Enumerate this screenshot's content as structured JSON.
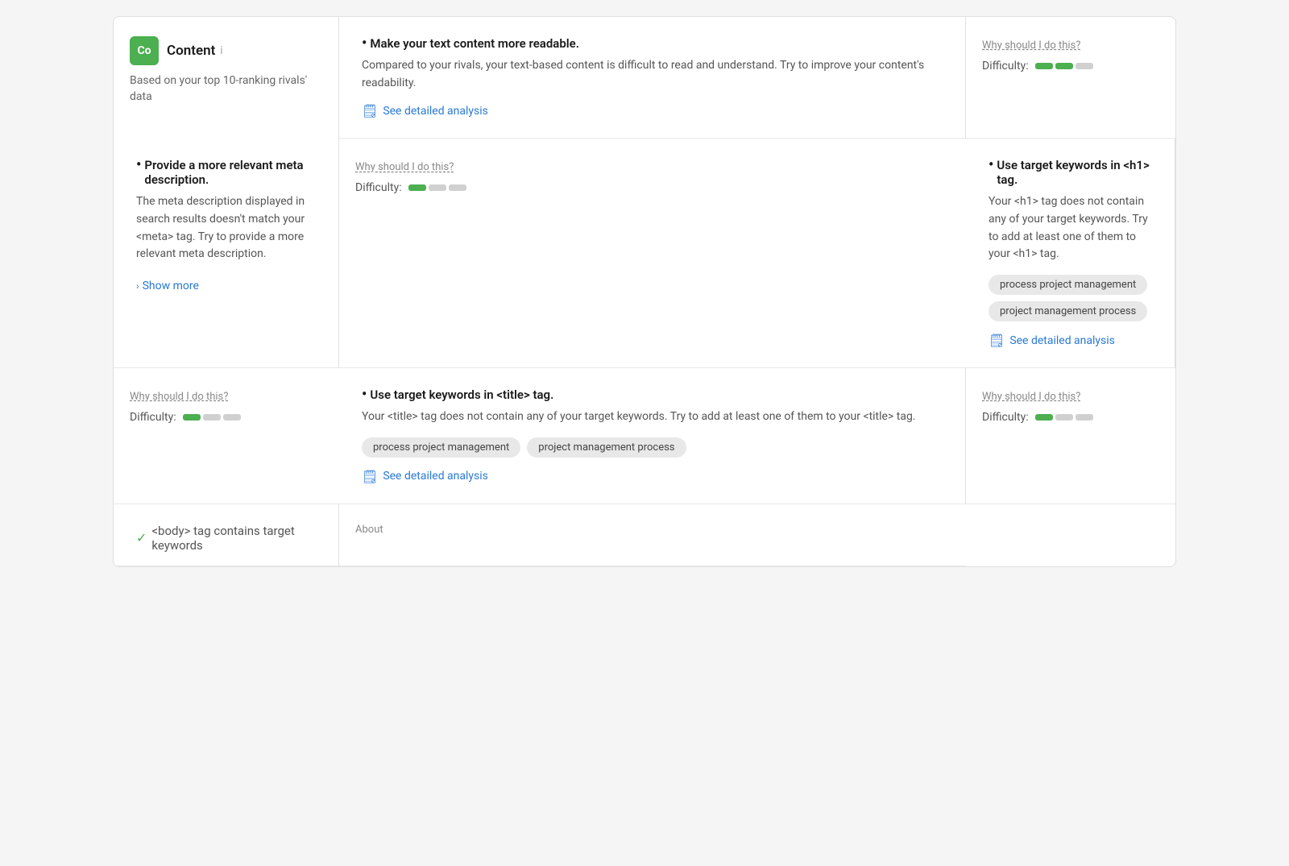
{
  "sidebar": {
    "logo_text": "Co",
    "logo_bg": "#4CAF50",
    "title": "Content",
    "subtitle": "Based on your top 10-ranking rivals' data"
  },
  "rows": [
    {
      "id": "readability",
      "title": "Make your text content more readable.",
      "description": "Compared to your rivals, your text-based content is difficult to read and understand. Try to improve your content's readability.",
      "action_type": "detail_link",
      "action_label": "See detailed analysis",
      "difficulty_bars": [
        2,
        3
      ],
      "why_label": "Why should I do this?"
    },
    {
      "id": "meta-description",
      "title": "Provide a more relevant meta description.",
      "description": "The meta description displayed in search results doesn't match your <meta> tag. Try to provide a more relevant meta description.",
      "action_type": "show_more",
      "action_label": "Show more",
      "difficulty_bars": [
        1,
        3
      ],
      "why_label": "Why should I do this?"
    },
    {
      "id": "h1-keywords",
      "title": "Use target keywords in <h1> tag.",
      "description": "Your <h1> tag does not contain any of your target keywords. Try to add at least one of them to your <h1> tag.",
      "tags": [
        "process project management",
        "project management process"
      ],
      "action_type": "detail_link",
      "action_label": "See detailed analysis",
      "difficulty_bars": [
        1,
        3
      ],
      "why_label": "Why should I do this?"
    },
    {
      "id": "title-keywords",
      "title": "Use target keywords in <title> tag.",
      "description": "Your <title> tag does not contain any of your target keywords. Try to add at least one of them to your <title> tag.",
      "tags": [
        "process project management",
        "project management process"
      ],
      "action_type": "detail_link",
      "action_label": "See detailed analysis",
      "difficulty_bars": [
        1,
        3
      ],
      "why_label": "Why should I do this?"
    }
  ],
  "partial_row": {
    "title": "<body> tag contains target keywords",
    "aside_label": "About"
  },
  "difficulty_label": "Difficulty:"
}
